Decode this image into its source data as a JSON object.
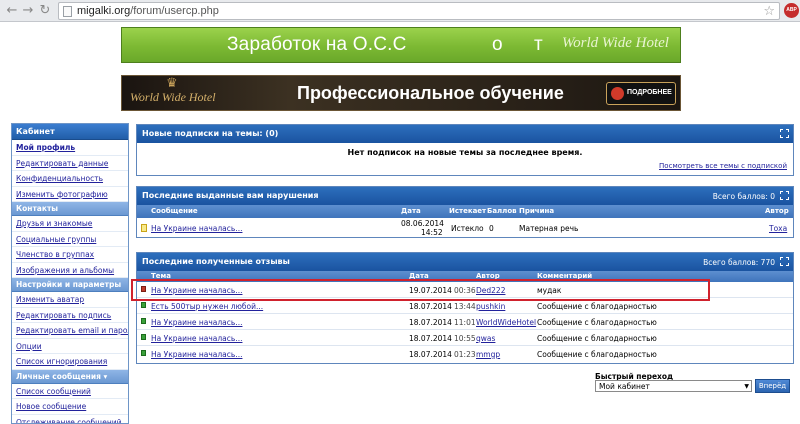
{
  "browser": {
    "url_domain": "migalki.org",
    "url_path": "/forum/usercp.php",
    "abp_label": "ABP"
  },
  "banners": {
    "top_left": "Заработок на О.С.С",
    "top_mid1": "о",
    "top_mid2": "т",
    "top_right": "World Wide Hotel",
    "bottom_logo": "World Wide Hotel",
    "bottom_main": "Профессиональное обучение",
    "bottom_button": "ПОДРОБНЕЕ"
  },
  "sidebar": {
    "title": "Кабинет",
    "sections": [
      {
        "title": "Мой профиль",
        "items": [
          "Редактировать данные",
          "Конфиденциальность",
          "Изменить фотографию"
        ]
      },
      {
        "title": "Контакты",
        "items": [
          "Друзья и знакомые",
          "Социальные группы",
          "Членство в группах",
          "Изображения и альбомы"
        ]
      },
      {
        "title": "Настройки и параметры",
        "items": [
          "Изменить аватар",
          "Редактировать подпись",
          "Редактировать email и пароль",
          "Опции",
          "Список игнорирования"
        ]
      },
      {
        "title": "Личные сообщения ▾",
        "items": [
          "Список сообщений",
          "Новое сообщение",
          "Отслеживание сообщений"
        ]
      }
    ]
  },
  "subscriptions": {
    "title": "Новые подписки на темы: (0)",
    "empty_text": "Нет подписок на новые темы за последнее время.",
    "view_all_link": "Посмотреть все темы с подпиской"
  },
  "infractions": {
    "title": "Последние выданные вам нарушения",
    "total_points": "Всего баллов: 0",
    "columns": [
      "Сообщение",
      "Дата",
      "Истекает",
      "Баллов",
      "Причина",
      "Автор"
    ],
    "rows": [
      {
        "message": "На Украине началась...",
        "date": "08.06.2014",
        "time": "14:52",
        "expires": "Истекло",
        "points": "0",
        "reason": "Матерная речь",
        "author": "Тоха"
      }
    ]
  },
  "feedback": {
    "title": "Последние полученные отзывы",
    "total_points": "Всего баллов: 770",
    "columns": [
      "Тема",
      "Дата",
      "Автор",
      "Комментарий"
    ],
    "rows": [
      {
        "status": "red",
        "topic": "На Украине началась...",
        "date": "19.07.2014",
        "time": "00:36",
        "author": "Ded222",
        "comment": "мудак"
      },
      {
        "status": "green",
        "topic": "Есть 500тыр нужен любой...",
        "date": "18.07.2014",
        "time": "13:44",
        "author": "pushkin",
        "comment": "Сообщение с благодарностью"
      },
      {
        "status": "green",
        "topic": "На Украине началась...",
        "date": "18.07.2014",
        "time": "11:01",
        "author": "WorldWideHotel",
        "comment": "Сообщение с благодарностью"
      },
      {
        "status": "green",
        "topic": "На Украине началась...",
        "date": "18.07.2014",
        "time": "10:55",
        "author": "qwas",
        "comment": "Сообщение с благодарностью"
      },
      {
        "status": "green",
        "topic": "На Украине началась...",
        "date": "18.07.2014",
        "time": "01:23",
        "author": "mmgp",
        "comment": "Сообщение с благодарностью"
      }
    ]
  },
  "quick_jump": {
    "label": "Быстрый переход",
    "selected": "Мой кабинет",
    "button": "Вперёд"
  }
}
